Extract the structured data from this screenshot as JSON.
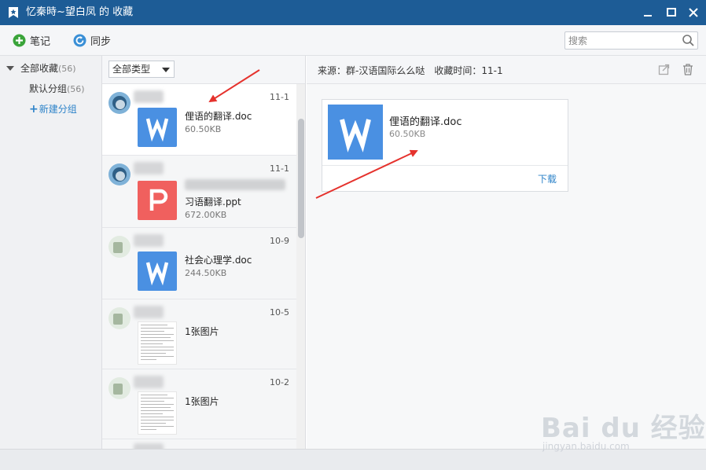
{
  "titlebar": {
    "title": "忆秦時~望白凤 的 收藏",
    "bg_color": "#1d5c96"
  },
  "toolbar": {
    "note_label": "笔记",
    "sync_label": "同步",
    "search_placeholder": "搜索"
  },
  "sidebar": {
    "all_label": "全部收藏",
    "all_count": "(56)",
    "default_label": "默认分组",
    "default_count": "(56)",
    "new_group_label": "新建分组"
  },
  "list": {
    "filter_label": "全部类型",
    "items": [
      {
        "date": "11-1",
        "file_name": "俚语的翻译.doc",
        "file_size": "60.50KB",
        "file_type": "word"
      },
      {
        "date": "11-1",
        "file_name": "习语翻译.ppt",
        "file_size": "672.00KB",
        "file_type": "ppt"
      },
      {
        "date": "10-9",
        "file_name": "社会心理学.doc",
        "file_size": "244.50KB",
        "file_type": "word"
      },
      {
        "date": "10-5",
        "file_name": "1张图片",
        "file_type": "image"
      },
      {
        "date": "10-2",
        "file_name": "1张图片",
        "file_type": "image"
      }
    ]
  },
  "detail": {
    "source_prefix": "来源：",
    "source_value": "群-汉语国际么么哒",
    "time_prefix": "收藏时间：",
    "time_value": "11-1",
    "attachment_name": "俚语的翻译.doc",
    "attachment_size": "60.50KB",
    "download_label": "下载"
  },
  "colors": {
    "word_blue": "#4a90e2",
    "ppt_red": "#f0605e",
    "link_blue": "#2d83c9",
    "arrow_red": "#e5322d"
  },
  "watermark": {
    "logo": "Bai du 经验",
    "sub": "jingyan.baidu.com"
  }
}
